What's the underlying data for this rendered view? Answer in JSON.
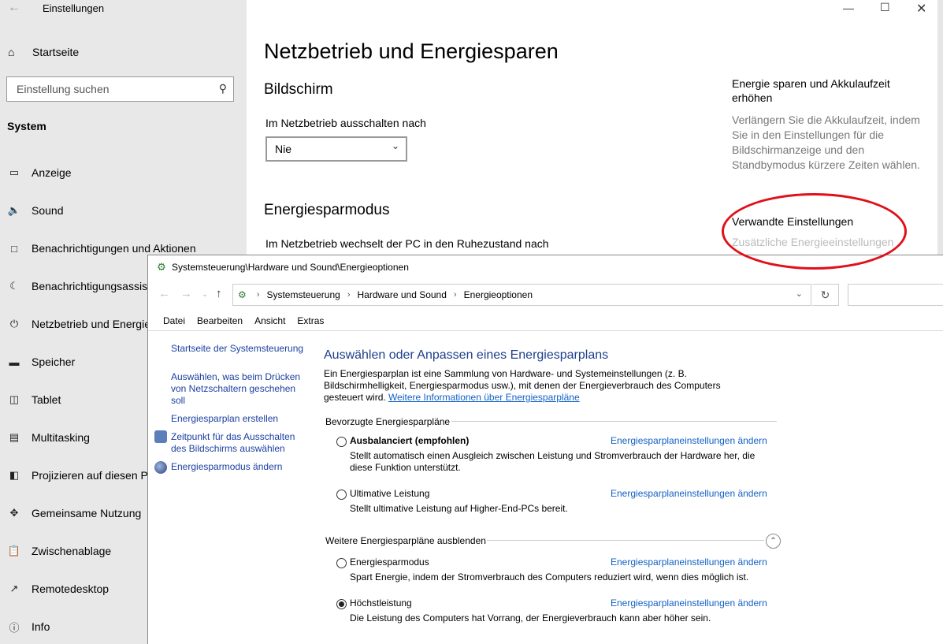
{
  "settings": {
    "window_title": "Einstellungen",
    "home_label": "Startseite",
    "search_placeholder": "Einstellung suchen",
    "section": "System",
    "nav_items": [
      {
        "label": "Anzeige",
        "icon": "display-icon"
      },
      {
        "label": "Sound",
        "icon": "speaker-icon"
      },
      {
        "label": "Benachrichtigungen und Aktionen",
        "icon": "notification-icon"
      },
      {
        "label": "Benachrichtigungsassistent",
        "icon": "moon-icon"
      },
      {
        "label": "Netzbetrieb und Energiesparen",
        "icon": "power-icon"
      },
      {
        "label": "Speicher",
        "icon": "storage-icon"
      },
      {
        "label": "Tablet",
        "icon": "tablet-icon"
      },
      {
        "label": "Multitasking",
        "icon": "multitasking-icon"
      },
      {
        "label": "Projizieren auf diesen PC",
        "icon": "project-icon"
      },
      {
        "label": "Gemeinsame Nutzung",
        "icon": "share-icon"
      },
      {
        "label": "Zwischenablage",
        "icon": "clipboard-icon"
      },
      {
        "label": "Remotedesktop",
        "icon": "remote-icon"
      },
      {
        "label": "Info",
        "icon": "info-icon"
      }
    ],
    "page_title": "Netzbetrieb und Energiesparen",
    "screen_heading": "Bildschirm",
    "screen_label": "Im Netzbetrieb ausschalten nach",
    "screen_value": "Nie",
    "sleep_heading": "Energiesparmodus",
    "sleep_label": "Im Netzbetrieb wechselt der PC in den Ruhezustand nach",
    "right_heading": "Energie sparen und Akkulaufzeit erhöhen",
    "right_text": "Verlängern Sie die Akkulaufzeit, indem Sie in den Einstellungen für die Bildschirmanzeige und den Standbymodus kürzere Zeiten wählen.",
    "related_heading": "Verwandte Einstellungen",
    "related_link": "Zusätzliche Energieeinstellungen"
  },
  "control_panel": {
    "title": "Systemsteuerung\\Hardware und Sound\\Energieoptionen",
    "breadcrumb": [
      "Systemsteuerung",
      "Hardware und Sound",
      "Energieoptionen"
    ],
    "menu": [
      "Datei",
      "Bearbeiten",
      "Ansicht",
      "Extras"
    ],
    "left_links": {
      "home": "Startseite der Systemsteuerung",
      "power_buttons": "Auswählen, was beim Drücken von Netzschaltern geschehen soll",
      "create_plan": "Energiesparplan erstellen",
      "display_off": "Zeitpunkt für das Ausschalten des Bildschirms auswählen",
      "sleep": "Energiesparmodus ändern"
    },
    "heading": "Auswählen oder Anpassen eines Energiesparplans",
    "description": "Ein Energiesparplan ist eine Sammlung von Hardware- und Systemeinstellungen (z. B. Bildschirmhelligkeit, Energiesparmodus usw.), mit denen der Energieverbrauch des Computers gesteuert wird.",
    "description_link": "Weitere Informationen über Energiesparpläne",
    "preferred_group": "Bevorzugte Energiesparpläne",
    "more_group": "Weitere Energiesparpläne ausblenden",
    "change_link": "Energiesparplaneinstellungen ändern",
    "plans": [
      {
        "name": "Ausbalanciert (empfohlen)",
        "desc": "Stellt automatisch einen Ausgleich zwischen Leistung und Stromverbrauch der Hardware her, die diese Funktion unterstützt.",
        "selected": false
      },
      {
        "name": "Ultimative Leistung",
        "desc": "Stellt ultimative Leistung auf Higher-End-PCs bereit.",
        "selected": false
      },
      {
        "name": "Energiesparmodus",
        "desc": "Spart Energie, indem der Stromverbrauch des Computers reduziert wird, wenn dies möglich ist.",
        "selected": false
      },
      {
        "name": "Höchstleistung",
        "desc": "Die Leistung des Computers hat Vorrang, der Energieverbrauch kann aber höher sein.",
        "selected": true
      }
    ]
  }
}
